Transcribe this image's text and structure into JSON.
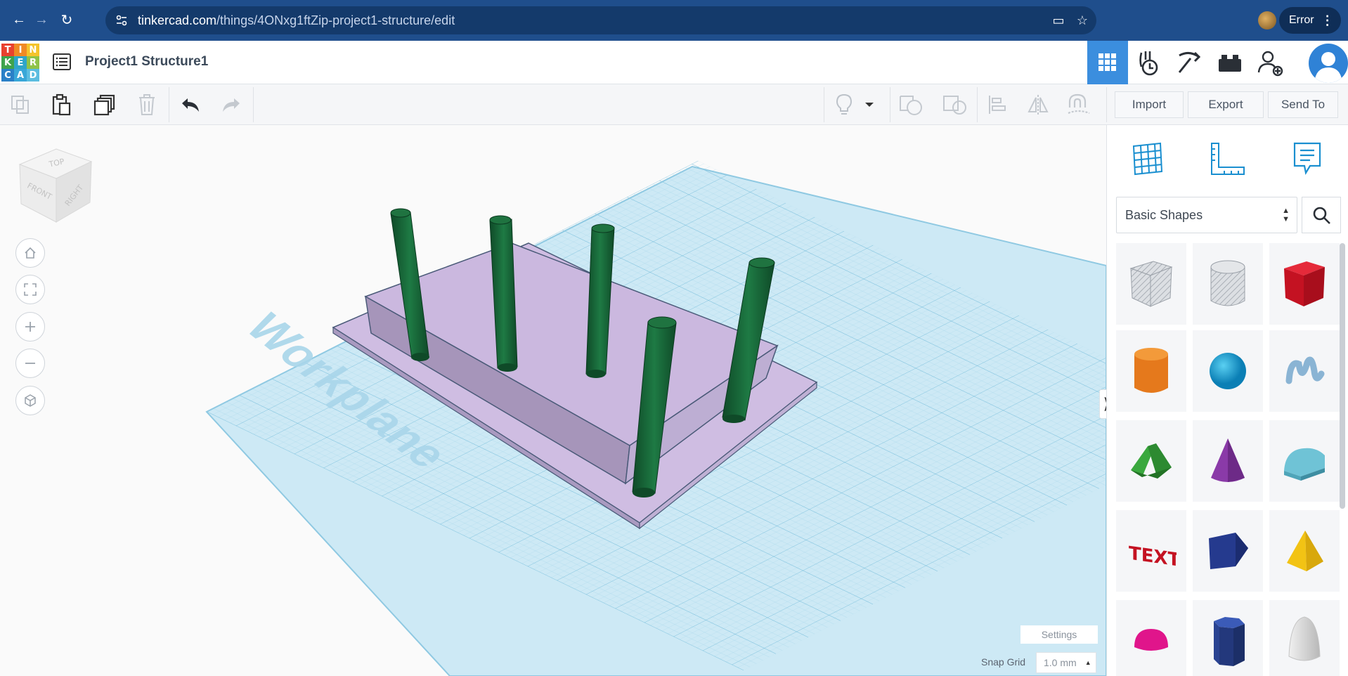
{
  "browser": {
    "url_domain": "tinkercad.com",
    "url_path": "/things/4ONxg1ftZip-project1-structure/edit",
    "error_label": "Error",
    "icons": [
      "back-icon",
      "forward-icon",
      "reload-icon",
      "site-settings-icon",
      "install-app-icon",
      "bookmark-star-icon",
      "kebab-menu-icon"
    ]
  },
  "app": {
    "logo_letters": [
      "T",
      "I",
      "N",
      "K",
      "E",
      "R",
      "C",
      "A",
      "D"
    ],
    "logo_colors": [
      "#e9412f",
      "#f08a24",
      "#f4c42b",
      "#3fa34d",
      "#2fa5c9",
      "#8fc348",
      "#2a80c7",
      "#39a7d8",
      "#5cbde0"
    ],
    "project_title": "Project1 Structure1",
    "header_tools": [
      "3d-design-icon",
      "codeblocks-icon",
      "minecraft-pickaxe-icon",
      "lego-brick-icon",
      "add-user-icon"
    ]
  },
  "toolbar": {
    "import_label": "Import",
    "export_label": "Export",
    "send_to_label": "Send To"
  },
  "viewport": {
    "viewcube_labels": {
      "top": "TOP",
      "front": "FRONT",
      "right": "RIGHT"
    },
    "workplane_label": "Workplane",
    "settings_label": "Settings",
    "snap_grid_label": "Snap Grid",
    "snap_grid_value": "1.0 mm",
    "colors": {
      "grid_plane": "#bfe5f4",
      "base_plate": "#c9b6de",
      "posts": "#1e6b3c"
    }
  },
  "panel": {
    "category": "Basic Shapes",
    "shapes": [
      "box-hole",
      "cylinder-hole",
      "box",
      "cylinder",
      "sphere",
      "scribble",
      "roof",
      "cone",
      "round-roof",
      "text",
      "polygon",
      "pyramid",
      "half-sphere",
      "hexagonal-prism",
      "paraboloid"
    ]
  }
}
